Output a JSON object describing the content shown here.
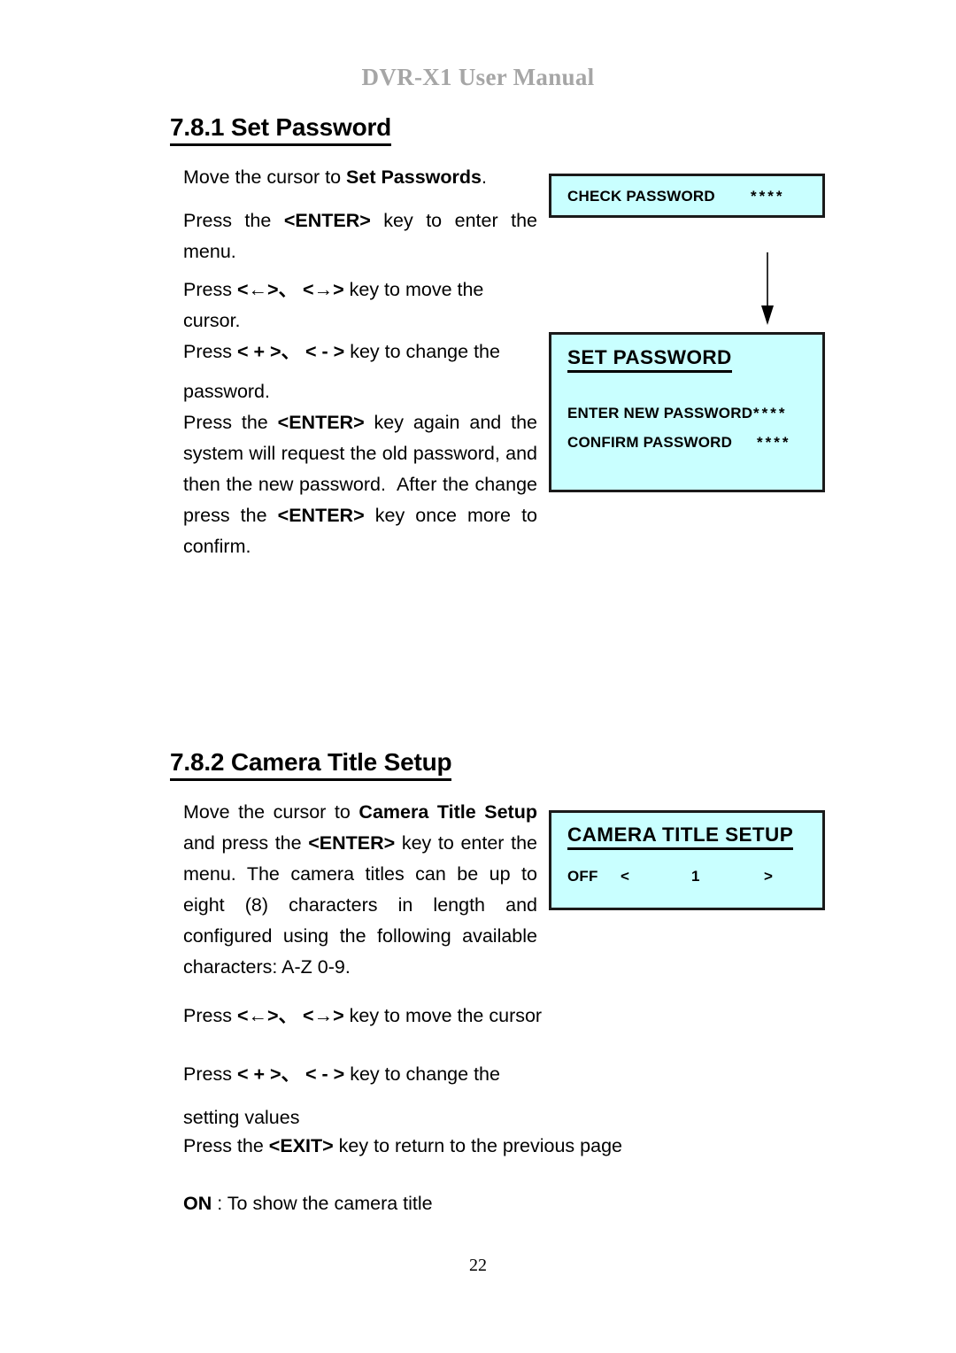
{
  "document": {
    "running_header": "DVR-X1 User Manual",
    "page_number": "22"
  },
  "sections": [
    {
      "id": "7.8.1",
      "heading": "7.8.1 Set Password",
      "paragraphs": {
        "a_prefix": "Move the cursor to ",
        "a_bold": "Set Passwords",
        "a_suffix": ".",
        "b_prefix": "Press the ",
        "b_bold": "<ENTER>",
        "b_suffix": " key to enter the menu.",
        "c_prefix": "Press ",
        "c_bold": "<←>、 <→>",
        "c_suffix": " key to move the cursor.",
        "d_prefix": "Press ",
        "d_bold": "< + >、 < - >",
        "d_suffix": " key to change the",
        "e_line1": "password.",
        "e_prefix": "Press the ",
        "e_bold1": "<ENTER>",
        "e_mid": " key again and the system will request the old password, and then the new password.  After the change press the ",
        "e_bold2": "<ENTER>",
        "e_suffix": " key once more to confirm."
      }
    },
    {
      "id": "7.8.2",
      "heading": "7.8.2 Camera Title Setup",
      "paragraphs": {
        "a_prefix": "Move the cursor to ",
        "a_bold1": "Camera Title Setup",
        "a_mid": " and press the ",
        "a_bold2": "<ENTER>",
        "a_suffix": " key to enter the menu. The camera titles can be up to eight (8) characters in length and configured using the following available characters: A-Z 0-9.",
        "b_prefix": "Press ",
        "b_bold": "<←>、 <→>",
        "b_suffix": " key to move the cursor",
        "c_prefix": "Press ",
        "c_bold": "< + >、 < - >",
        "c_suffix": " key to change the",
        "d_line": "setting values",
        "e_prefix": "Press the ",
        "e_bold": "<EXIT>",
        "e_suffix": " key to return to the previous page",
        "f_bold": "ON",
        "f_suffix": " : To show the camera title"
      }
    }
  ],
  "panels": {
    "check_password": {
      "label": "CHECK PASSWORD",
      "value": "****"
    },
    "set_password": {
      "title": "SET PASSWORD",
      "rows": [
        {
          "label": "ENTER NEW PASSWORD",
          "value": "****"
        },
        {
          "label": "CONFIRM PASSWORD",
          "value": "****"
        }
      ]
    },
    "camera_title_setup": {
      "title": "CAMERA TITLE SETUP",
      "state": "OFF",
      "prev": "<",
      "channel": "1",
      "next": ">"
    }
  },
  "colors": {
    "lcd_background": "#C9FFFF",
    "lcd_border": "#1A1A1A",
    "header_text": "#A6A6A6",
    "body_text": "#000000"
  },
  "icons": {
    "flow_arrow": "down-arrow-icon"
  }
}
